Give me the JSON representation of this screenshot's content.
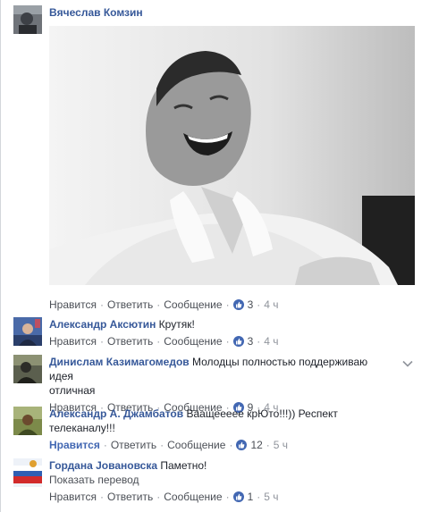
{
  "comments": [
    {
      "author": "Вячеслав Комзин",
      "text": "",
      "actions": {
        "like": "Нравится",
        "reply": "Ответить",
        "message": "Сообщение",
        "likes": "3",
        "time": "4 ч"
      }
    },
    {
      "author": "Александр Аксютин",
      "text": "Крутяк!",
      "actions": {
        "like": "Нравится",
        "reply": "Ответить",
        "message": "Сообщение",
        "likes": "3",
        "time": "4 ч"
      }
    },
    {
      "author": "Динислам Казимагомедов",
      "text_line1": "Молодцы полностью поддерживаю идея",
      "text_line2": "отличная",
      "actions": {
        "like": "Нравится",
        "reply": "Ответить",
        "message": "Сообщение",
        "likes": "9",
        "time": "4 ч"
      }
    },
    {
      "author": "Александр А. Джамбатов",
      "text_line1": "Ваащеееее крЮто!!!)) Респект",
      "text_line2": "телеканалу!!!",
      "actions": {
        "like": "Нравится",
        "reply": "Ответить",
        "message": "Сообщение",
        "likes": "12",
        "time": "5 ч"
      }
    },
    {
      "author": "Гордана Јовановска",
      "text": "Паметно!",
      "translate": "Показать перевод",
      "actions": {
        "like": "Нравится",
        "reply": "Ответить",
        "message": "Сообщение",
        "likes": "1",
        "time": "5 ч"
      }
    }
  ],
  "colors": {
    "link": "#365899",
    "like_active": "#4267b2",
    "meta": "#90949c"
  },
  "icons": [
    "like-icon",
    "chevron-down-icon"
  ]
}
